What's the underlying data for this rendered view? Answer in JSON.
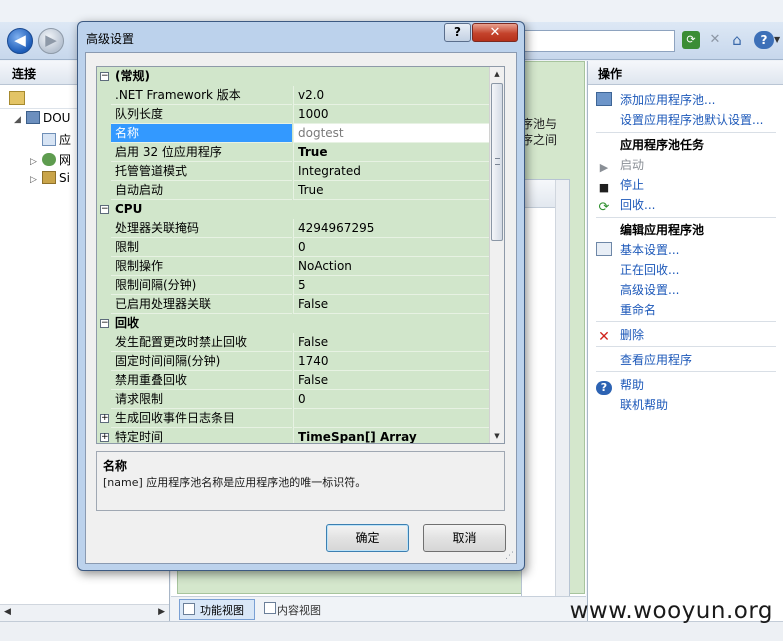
{
  "background": {
    "connections": {
      "header": "连接",
      "tree": [
        {
          "label": "DOU",
          "expander": "◢"
        },
        {
          "label": "应",
          "expander": ""
        },
        {
          "label": "网",
          "expander": "▷"
        },
        {
          "label": "Si",
          "expander": "▷"
        }
      ]
    },
    "center": {
      "text_line1": "序池与",
      "text_line2": "序之间",
      "tabs": {
        "feature": "功能视图",
        "content": "内容视图"
      }
    },
    "actions": {
      "header": "操作",
      "items": [
        {
          "label": "添加应用程序池...",
          "icon": "add-pool-icon"
        },
        {
          "label": "设置应用程序池默认设置...",
          "icon": ""
        },
        {
          "label": "应用程序池任务",
          "icon": ""
        },
        {
          "label": "启动",
          "icon": "play-icon"
        },
        {
          "label": "停止",
          "icon": "stop-icon"
        },
        {
          "label": "回收...",
          "icon": "recycle-icon"
        },
        {
          "label": "编辑应用程序池",
          "icon": ""
        },
        {
          "label": "基本设置...",
          "icon": "settings-icon"
        },
        {
          "label": "正在回收...",
          "icon": ""
        },
        {
          "label": "高级设置...",
          "icon": ""
        },
        {
          "label": "重命名",
          "icon": ""
        },
        {
          "label": "删除",
          "icon": "delete-icon"
        },
        {
          "label": "查看应用程序",
          "icon": ""
        },
        {
          "label": "帮助",
          "icon": "help-icon"
        },
        {
          "label": "联机帮助",
          "icon": ""
        }
      ]
    },
    "watermark": "www.wooyun.org"
  },
  "dialog": {
    "title": "高级设置",
    "help_btn": "?",
    "close_btn": "✕",
    "categories": [
      {
        "name": "(常规)",
        "expander": "⊟",
        "rows": [
          {
            "name": ".NET Framework 版本",
            "value": "v2.0"
          },
          {
            "name": "队列长度",
            "value": "1000"
          },
          {
            "name": "名称",
            "value": "dogtest",
            "selected": true
          },
          {
            "name": "启用 32 位应用程序",
            "value": "True",
            "bold": true
          },
          {
            "name": "托管管道模式",
            "value": "Integrated"
          },
          {
            "name": "自动启动",
            "value": "True"
          }
        ]
      },
      {
        "name": "CPU",
        "expander": "⊟",
        "rows": [
          {
            "name": "处理器关联掩码",
            "value": "4294967295"
          },
          {
            "name": "限制",
            "value": "0"
          },
          {
            "name": "限制操作",
            "value": "NoAction"
          },
          {
            "name": "限制间隔(分钟)",
            "value": "5"
          },
          {
            "name": "已启用处理器关联",
            "value": "False"
          }
        ]
      },
      {
        "name": "回收",
        "expander": "⊟",
        "rows": [
          {
            "name": "发生配置更改时禁止回收",
            "value": "False"
          },
          {
            "name": "固定时间间隔(分钟)",
            "value": "1740"
          },
          {
            "name": "禁用重叠回收",
            "value": "False"
          },
          {
            "name": "请求限制",
            "value": "0"
          },
          {
            "name": "生成回收事件日志条目",
            "value": "",
            "expandable": true
          },
          {
            "name": "特定时间",
            "value": "TimeSpan[] Array",
            "bold": true,
            "expandable": true
          }
        ]
      }
    ],
    "description": {
      "title": "名称",
      "text": "[name] 应用程序池名称是应用程序池的唯一标识符。"
    },
    "buttons": {
      "ok": "确定",
      "cancel": "取消"
    }
  }
}
